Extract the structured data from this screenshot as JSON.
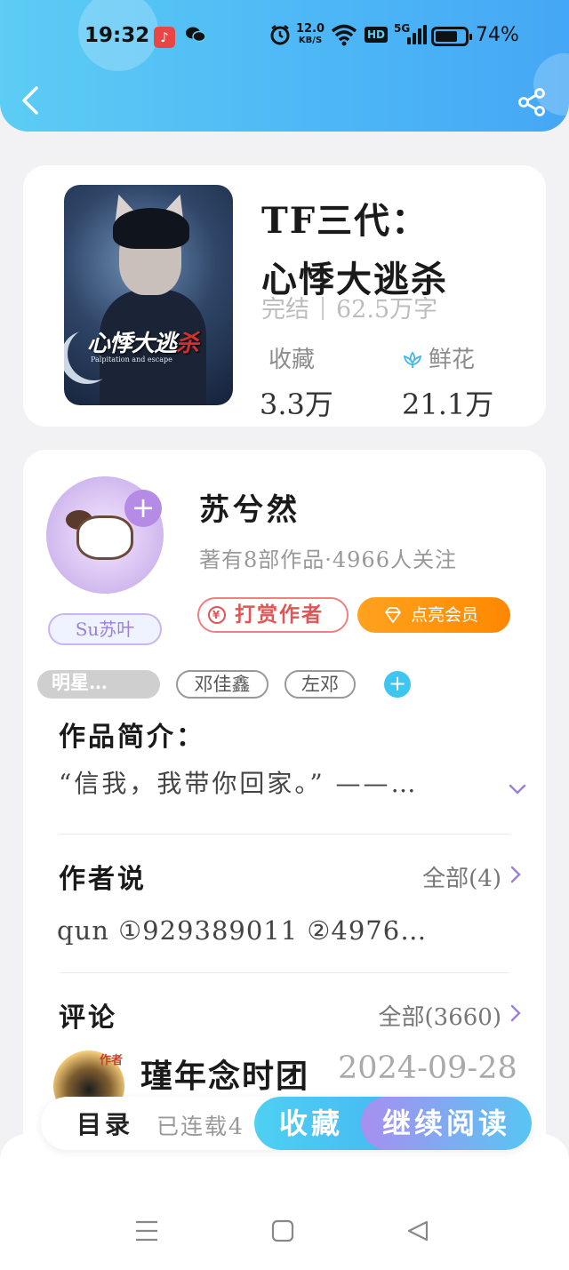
{
  "status_bar": {
    "time": "19:32",
    "net_speed_value": "12.0",
    "net_speed_unit": "KB/S",
    "hd": "HD",
    "signal": "5G",
    "battery_percent": "74%",
    "battery_level": 0.74,
    "icons": [
      "music-app-icon",
      "wechat-icon",
      "alarm-icon",
      "wifi-icon",
      "signal-icon",
      "battery-icon"
    ]
  },
  "header": {
    "back_icon": "chevron-left-icon",
    "share_icon": "share-icon",
    "accent_color": "#4cb6f6"
  },
  "book": {
    "title_line1": "TF三代：",
    "title_line2": "心悸大逃杀",
    "status": "完结",
    "word_count": "62.5万字",
    "favorites_label": "收藏",
    "favorites_value": "3.3万",
    "flowers_label": "鲜花",
    "flowers_value": "21.1万",
    "cover": {
      "title_main": "心悸大逃",
      "title_accent": "杀",
      "subtitle": "Palpitation and escape"
    }
  },
  "author": {
    "name": "苏兮然",
    "info": "著有8部作品·4966人关注",
    "avatar_tag": "Su苏叶",
    "tip_label": "打赏作者",
    "tip_icon": "yen-icon",
    "vip_label": "点亮会员",
    "vip_icon": "diamond-icon"
  },
  "tags": [
    "明星…",
    "邓佳鑫",
    "左邓"
  ],
  "intro": {
    "heading": "作品简介：",
    "text": "“信我，我带你回家。” ——…"
  },
  "author_says": {
    "heading": "作者说",
    "more": "全部(4)",
    "text": "qun ①929389011 ②4976…"
  },
  "comments": {
    "heading": "评论",
    "more": "全部(3660)",
    "first_user": "瑾年念时团",
    "first_badge": "作者",
    "first_date": "2024-09-28"
  },
  "action_bar": {
    "toc": "目录",
    "serial": "已连载4",
    "favorite": "收藏",
    "continue": "继续阅读"
  },
  "system_nav": {
    "icons": [
      "menu-icon",
      "home-square-icon",
      "back-triangle-icon"
    ]
  }
}
